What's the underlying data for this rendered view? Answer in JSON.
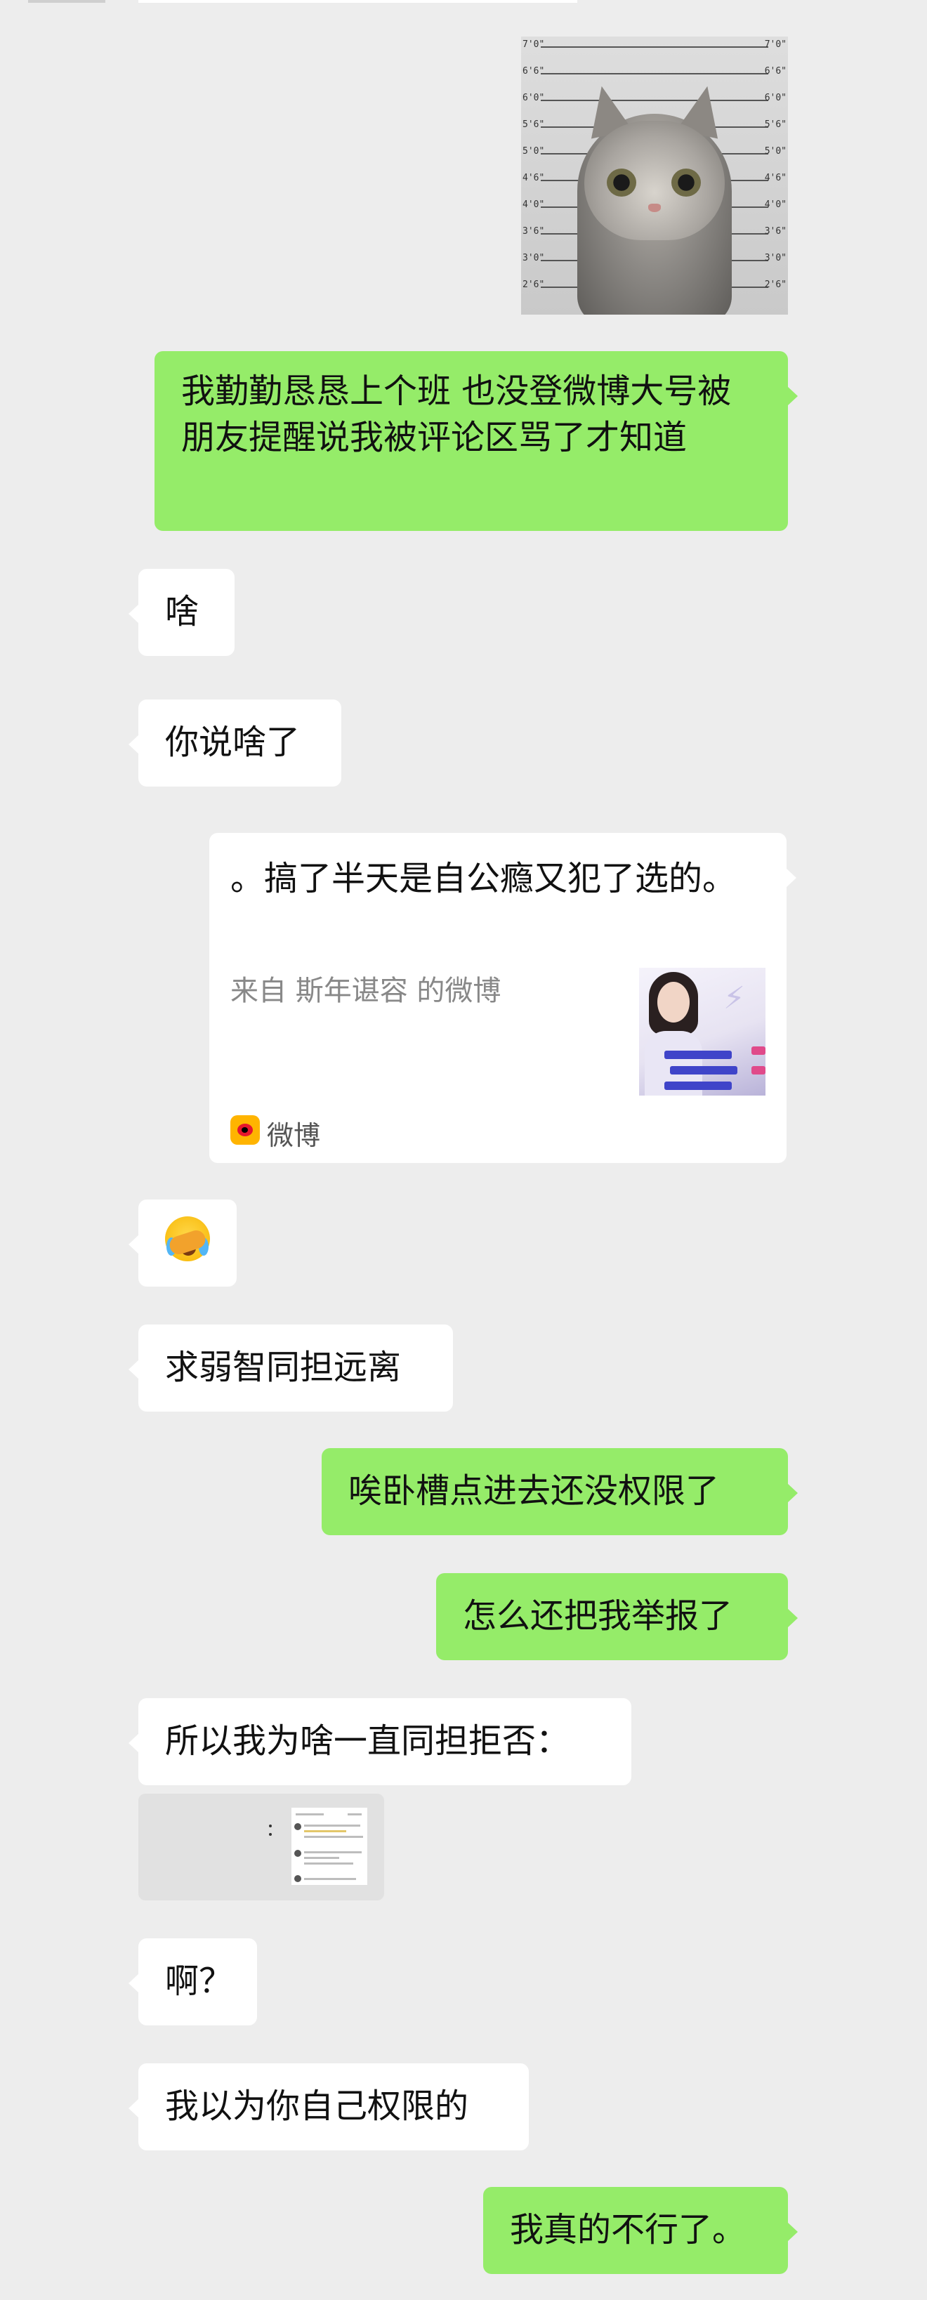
{
  "messages": {
    "m1": "我勤勤恳恳上个班 也没登微博大号被朋友提醒说我被评论区骂了才知道",
    "m2": "啥",
    "m3": "你说啥了",
    "m5": "求弱智同担远离",
    "m6": "唉卧槽点进去还没权限了",
    "m7": "怎么还把我举报了",
    "m8": "所以我为啥一直同担拒否：",
    "m10": "啊？",
    "m11": "我以为你自己权限的",
    "m12": "我真的不行了。"
  },
  "image_message": {
    "scale_labels": [
      "7'0\"",
      "6'6\"",
      "6'0\"",
      "5'6\"",
      "5'0\"",
      "4'6\"",
      "4'0\"",
      "3'6\"",
      "3'0\"",
      "2'6\""
    ],
    "right_labels": [
      "7'0\"",
      "6'6\"",
      "6'0\"",
      "5'6\"",
      "5'0\"",
      "4'6\"",
      "4'0\"",
      "3'6\"",
      "3'0\"",
      "2'6\""
    ]
  },
  "link_card": {
    "title": "。搞了半天是自公瘾又犯了选的。",
    "source": "来自 斯年谌容 的微博",
    "app_name": "微博"
  },
  "colors": {
    "background": "#ededed",
    "incoming_bubble": "#ffffff",
    "outgoing_bubble": "#95ec69"
  }
}
